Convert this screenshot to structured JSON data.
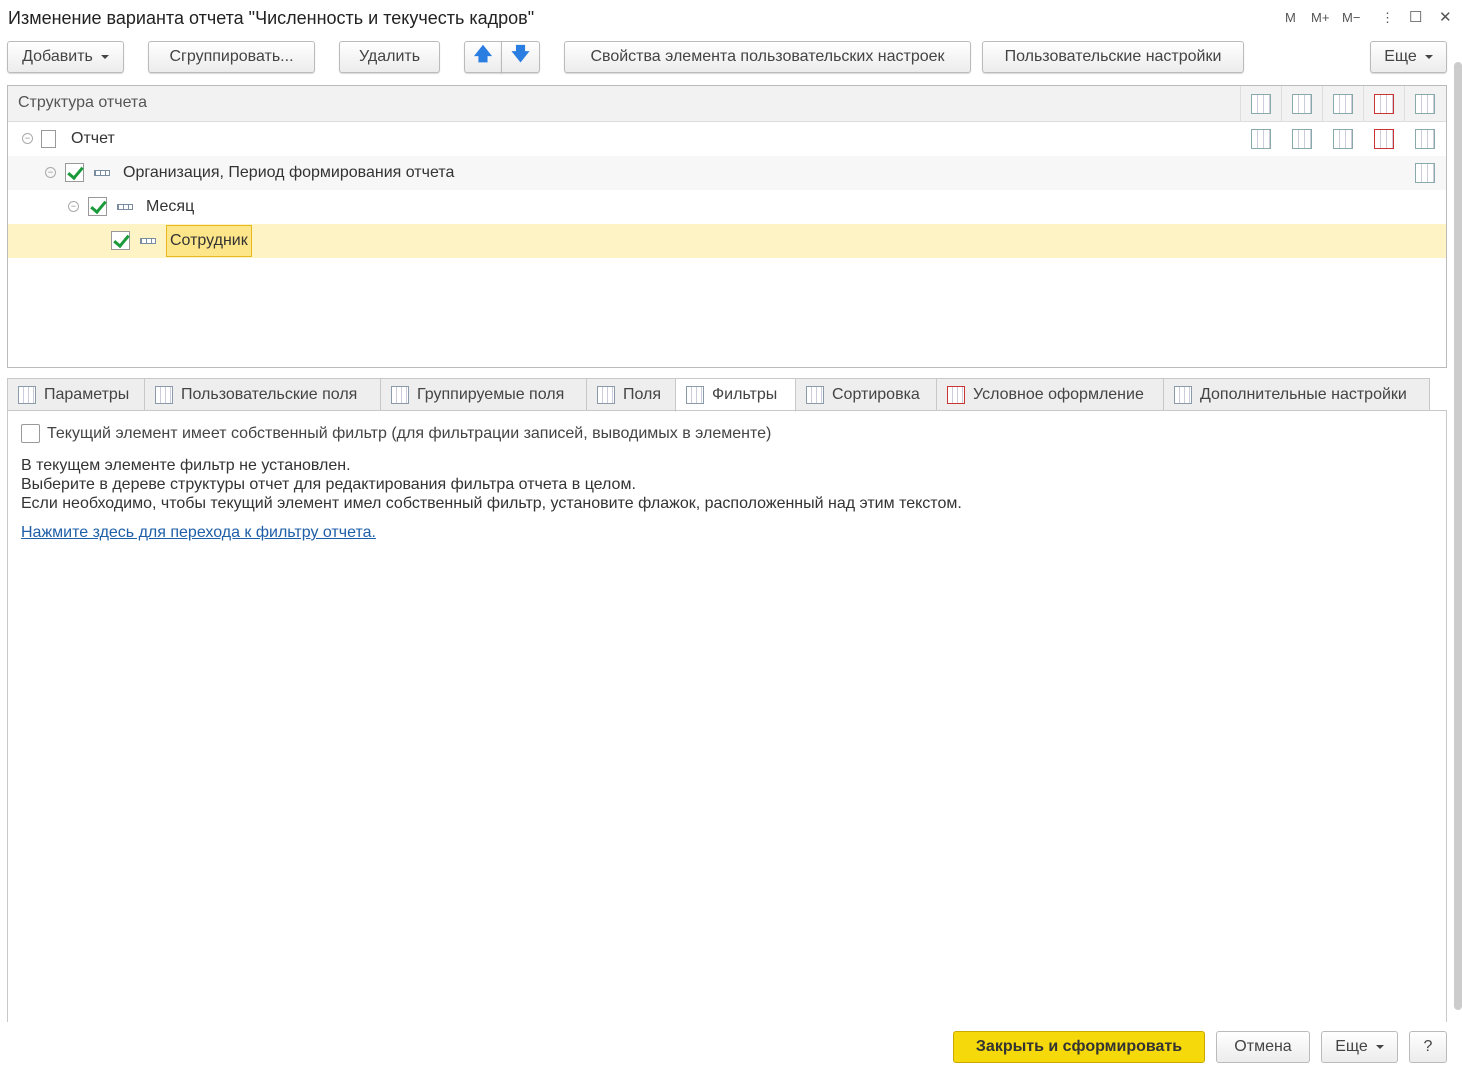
{
  "window": {
    "title": "Изменение варианта отчета \"Численность и текучесть кадров\"",
    "controls": [
      "M",
      "M+",
      "M−",
      "⋮",
      "☐",
      "✕"
    ]
  },
  "toolbar": {
    "add": "Добавить",
    "group": "Сгруппировать...",
    "delete": "Удалить",
    "up": "🡅",
    "down": "🡇",
    "properties": "Свойства элемента пользовательских настроек",
    "user_settings": "Пользовательские настройки",
    "more": "Еще"
  },
  "tree": {
    "header": "Структура отчета",
    "rows": [
      {
        "label": "Отчет"
      },
      {
        "label": "Организация, Период формирования отчета"
      },
      {
        "label": "Месяц"
      },
      {
        "label": "Сотрудник"
      }
    ]
  },
  "tabs": [
    {
      "label": "Параметры"
    },
    {
      "label": "Пользовательские поля"
    },
    {
      "label": "Группируемые поля"
    },
    {
      "label": "Поля"
    },
    {
      "label": "Фильтры"
    },
    {
      "label": "Сортировка"
    },
    {
      "label": "Условное оформление"
    },
    {
      "label": "Дополнительные настройки"
    }
  ],
  "filters": {
    "own_filter_label": "Текущий элемент имеет собственный фильтр (для фильтрации записей, выводимых в элементе)",
    "info": [
      "В текущем элементе фильтр не установлен.",
      "Выберите в дереве структуры отчет для редактирования фильтра отчета в целом.",
      "Если необходимо, чтобы текущий элемент имел собственный фильтр, установите флажок, расположенный над этим текстом."
    ],
    "link": "Нажмите здесь для перехода к фильтру отчета."
  },
  "footer": {
    "close_generate": "Закрыть и сформировать",
    "cancel": "Отмена",
    "more": "Еще",
    "help": "?"
  },
  "colors": {
    "accent": "#f5d90a",
    "selection": "#fdf3c4",
    "link": "#1f5fa8"
  }
}
